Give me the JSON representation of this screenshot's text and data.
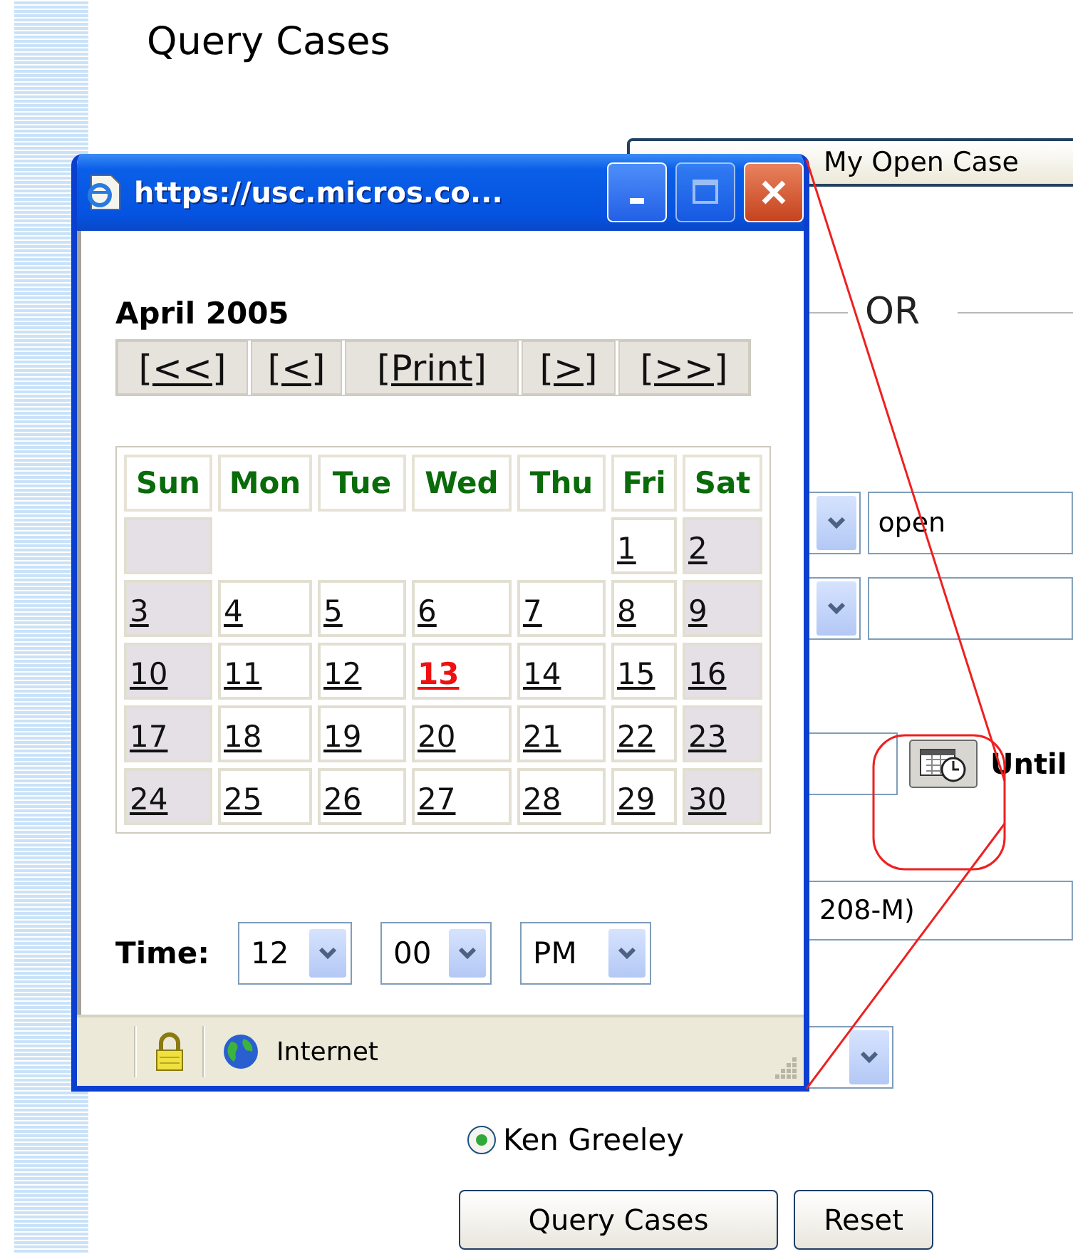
{
  "page": {
    "title": "Query Cases",
    "my_cases_button": "My Open Case",
    "or_label": "OR",
    "rows": [
      {
        "kind": "select-input",
        "value": "open"
      },
      {
        "kind": "select-input"
      },
      {
        "kind": "date",
        "label": "Until"
      },
      {
        "kind": "input",
        "value": "208-M)"
      },
      {
        "kind": "select"
      }
    ],
    "radio": {
      "label": "Ken Greeley",
      "selected": true
    },
    "buttons": [
      "Query Cases",
      "Reset"
    ]
  },
  "popup": {
    "title": "https://usc.micros.co...",
    "calendar": {
      "month": "April 2005",
      "nav": [
        "[<<]",
        "[<]",
        "[Print]",
        "[>]",
        "[>>]"
      ],
      "weekdays": [
        "Sun",
        "Mon",
        "Tue",
        "Wed",
        "Thu",
        "Fri",
        "Sat"
      ],
      "weeks": [
        [
          {
            "kind": "pad",
            "weekend": true
          },
          {
            "kind": "gap"
          },
          {
            "kind": "gap"
          },
          {
            "kind": "gap"
          },
          {
            "kind": "gap"
          },
          {
            "kind": "day",
            "day": "1",
            "weekend": false,
            "selected": false
          },
          {
            "kind": "day",
            "day": "2",
            "weekend": true,
            "selected": false
          }
        ],
        [
          {
            "kind": "day",
            "day": "3",
            "weekend": true,
            "selected": false
          },
          {
            "kind": "day",
            "day": "4",
            "weekend": false,
            "selected": false
          },
          {
            "kind": "day",
            "day": "5",
            "weekend": false,
            "selected": false
          },
          {
            "kind": "day",
            "day": "6",
            "weekend": false,
            "selected": false
          },
          {
            "kind": "day",
            "day": "7",
            "weekend": false,
            "selected": false
          },
          {
            "kind": "day",
            "day": "8",
            "weekend": false,
            "selected": false
          },
          {
            "kind": "day",
            "day": "9",
            "weekend": true,
            "selected": false
          }
        ],
        [
          {
            "kind": "day",
            "day": "10",
            "weekend": true,
            "selected": false
          },
          {
            "kind": "day",
            "day": "11",
            "weekend": false,
            "selected": false
          },
          {
            "kind": "day",
            "day": "12",
            "weekend": false,
            "selected": false
          },
          {
            "kind": "day",
            "day": "13",
            "weekend": false,
            "selected": true
          },
          {
            "kind": "day",
            "day": "14",
            "weekend": false,
            "selected": false
          },
          {
            "kind": "day",
            "day": "15",
            "weekend": false,
            "selected": false
          },
          {
            "kind": "day",
            "day": "16",
            "weekend": true,
            "selected": false
          }
        ],
        [
          {
            "kind": "day",
            "day": "17",
            "weekend": true,
            "selected": false
          },
          {
            "kind": "day",
            "day": "18",
            "weekend": false,
            "selected": false
          },
          {
            "kind": "day",
            "day": "19",
            "weekend": false,
            "selected": false
          },
          {
            "kind": "day",
            "day": "20",
            "weekend": false,
            "selected": false
          },
          {
            "kind": "day",
            "day": "21",
            "weekend": false,
            "selected": false
          },
          {
            "kind": "day",
            "day": "22",
            "weekend": false,
            "selected": false
          },
          {
            "kind": "day",
            "day": "23",
            "weekend": true,
            "selected": false
          }
        ],
        [
          {
            "kind": "day",
            "day": "24",
            "weekend": true,
            "selected": false
          },
          {
            "kind": "day",
            "day": "25",
            "weekend": false,
            "selected": false
          },
          {
            "kind": "day",
            "day": "26",
            "weekend": false,
            "selected": false
          },
          {
            "kind": "day",
            "day": "27",
            "weekend": false,
            "selected": false
          },
          {
            "kind": "day",
            "day": "28",
            "weekend": false,
            "selected": false
          },
          {
            "kind": "day",
            "day": "29",
            "weekend": false,
            "selected": false
          },
          {
            "kind": "day",
            "day": "30",
            "weekend": true,
            "selected": false
          }
        ]
      ]
    },
    "time": {
      "label": "Time:",
      "selects": [
        "12",
        "00",
        "PM"
      ]
    },
    "status": {
      "zone": "Internet"
    }
  }
}
